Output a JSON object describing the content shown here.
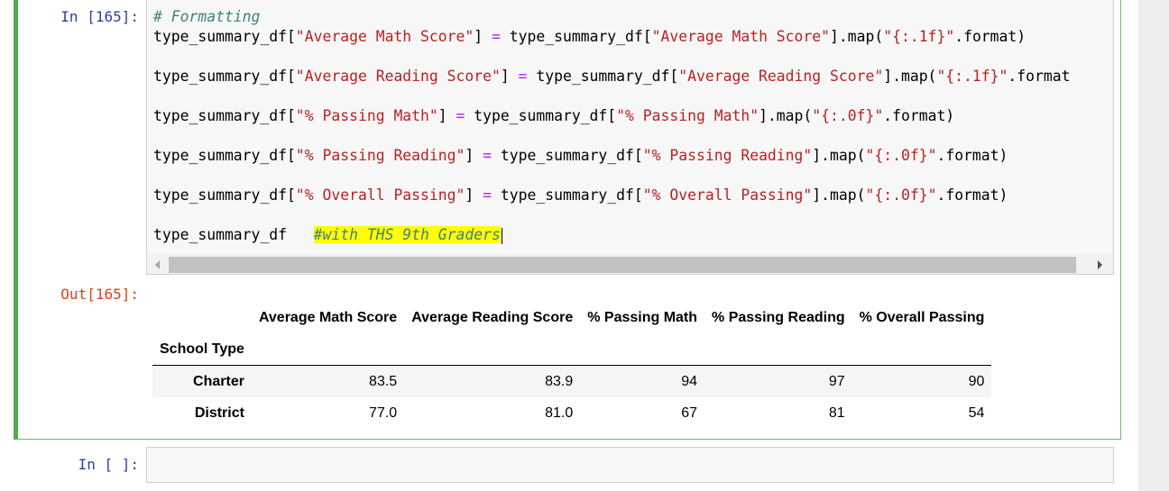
{
  "cell1": {
    "in_prompt": "In [165]:",
    "out_prompt": "Out[165]:",
    "code": {
      "comment": "# Formatting",
      "lines": [
        {
          "lhs": "type_summary_df[",
          "key": "\"Average Math Score\"",
          "mid": "] ",
          "eq": "=",
          "rhs1": " type_summary_df[",
          "key2": "\"Average Math Score\"",
          "rhs2": "].map(",
          "fmt": "\"{:.1f}\"",
          "tail": ".format)"
        },
        {
          "lhs": "type_summary_df[",
          "key": "\"Average Reading Score\"",
          "mid": "] ",
          "eq": "=",
          "rhs1": " type_summary_df[",
          "key2": "\"Average Reading Score\"",
          "rhs2": "].map(",
          "fmt": "\"{:.1f}\"",
          "tail": ".format"
        },
        {
          "lhs": "type_summary_df[",
          "key": "\"% Passing Math\"",
          "mid": "] ",
          "eq": "=",
          "rhs1": " type_summary_df[",
          "key2": "\"% Passing Math\"",
          "rhs2": "].map(",
          "fmt": "\"{:.0f}\"",
          "tail": ".format)"
        },
        {
          "lhs": "type_summary_df[",
          "key": "\"% Passing Reading\"",
          "mid": "] ",
          "eq": "=",
          "rhs1": " type_summary_df[",
          "key2": "\"% Passing Reading\"",
          "rhs2": "].map(",
          "fmt": "\"{:.0f}\"",
          "tail": ".format)"
        },
        {
          "lhs": "type_summary_df[",
          "key": "\"% Overall Passing\"",
          "mid": "] ",
          "eq": "=",
          "rhs1": " type_summary_df[",
          "key2": "\"% Overall Passing\"",
          "rhs2": "].map(",
          "fmt": "\"{:.0f}\"",
          "tail": ".format)"
        }
      ],
      "last_var": "type_summary_df   ",
      "last_comment": "#with THS 9th Graders"
    },
    "table": {
      "columns": [
        "Average Math Score",
        "Average Reading Score",
        "% Passing Math",
        "% Passing Reading",
        "% Overall Passing"
      ],
      "index_name": "School Type",
      "rows": [
        {
          "index": "Charter",
          "values": [
            "83.5",
            "83.9",
            "94",
            "97",
            "90"
          ]
        },
        {
          "index": "District",
          "values": [
            "77.0",
            "81.0",
            "67",
            "81",
            "54"
          ]
        }
      ]
    }
  },
  "cell2": {
    "in_prompt": "In [ ]:"
  }
}
